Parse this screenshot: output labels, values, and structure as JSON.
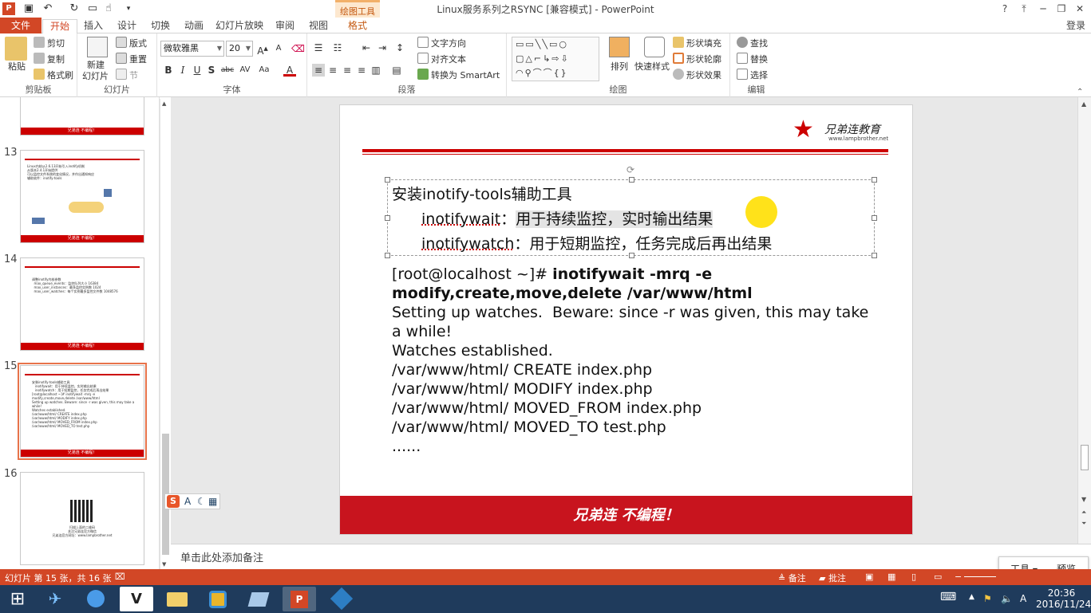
{
  "window": {
    "title": "Linux服务系列之RSYNC [兼容模式] - PowerPoint",
    "context_tab_group": "绘图工具",
    "help": "?",
    "minimize": "─",
    "restore": "❐",
    "close": "✕",
    "login": "登录"
  },
  "tabs": [
    "文件",
    "开始",
    "插入",
    "设计",
    "切换",
    "动画",
    "幻灯片放映",
    "审阅",
    "视图",
    "格式"
  ],
  "active_tab": "开始",
  "ribbon": {
    "clipboard": {
      "paste": "粘贴",
      "cut": "剪切",
      "copy": "复制",
      "format_painter": "格式刷",
      "label": "剪贴板"
    },
    "slides": {
      "new_slide": "新建",
      "new_slide2": "幻灯片",
      "layout": "版式",
      "reset": "重置",
      "section": "节",
      "label": "幻灯片"
    },
    "font": {
      "name": "微软雅黑",
      "size": "20",
      "bold": "B",
      "italic": "I",
      "underline": "U",
      "shadow": "S",
      "strike": "abc",
      "spacing": "AV",
      "case": "Aa",
      "color": "A",
      "label": "字体"
    },
    "paragraph": {
      "text_direction": "文字方向",
      "align_text": "对齐文本",
      "smartart": "转换为 SmartArt",
      "label": "段落"
    },
    "drawing": {
      "arrange": "排列",
      "quick_styles": "快速样式",
      "shape_fill": "形状填充",
      "shape_outline": "形状轮廓",
      "shape_effects": "形状效果",
      "label": "绘图"
    },
    "editing": {
      "find": "查找",
      "replace": "替换",
      "select": "选择",
      "label": "编辑"
    }
  },
  "thumbnails": [
    {
      "num": "13",
      "text": "Linux内核从2.6.13开始引入inotify机制\n从版本2.4.1开始提供\n可以监控文件系统的变化情况，并作出通知响应\n辅助软件：inotify-tools"
    },
    {
      "num": "14",
      "text": "调整inotify内核参数\n  max_queue_events：监控队列大小 16384\n  max_user_instances：最多监控实例数 1024\n  max_user_watches：每个实例最多监控文件数 1048576"
    },
    {
      "num": "15",
      "text": "安装inotify-tools辅助工具\n   inotifywait：用于持续监控，实时输出结果\n   inotifywatch：用于短期监控，任务完成后再出结果\n[root@localhost ~]# inotifywait -mrq -e\nmodify,create,move,delete /var/www/html\nSetting up watches. Beware: since -r was given, this may take a while!\nWatches established.\n/var/www/html/ CREATE index.php\n/var/www/html/ MODIFY index.php\n/var/www/html/ MOVED_FROM index.php\n/var/www/html/ MOVED_TO test.php"
    },
    {
      "num": "16",
      "text": "扫描上面的二维码\n关注兄弟连官方微信\n兄弟连官方网址：www.lampbrother.net"
    }
  ],
  "thumb_footer": "兄弟连 不编程！",
  "slide": {
    "logo_text": "兄弟连教育",
    "logo_url": "www.lampbrother.net",
    "heading": "安装inotify-tools辅助工具",
    "line1_term": "inotifywait",
    "line1_sep": "：",
    "line1_desc": "用于持续监控，实时输出结果",
    "line2_term": "inotifywatch",
    "line2_sep": "：",
    "line2_desc": "用于短期监控，任务完成后再出结果",
    "code_prompt": "[root@localhost ~]# ",
    "code_cmd1": "inotifywait -mrq -e",
    "code_cmd2": "modify,create,move,delete /var/www/html",
    "code_out": "Setting up watches.  Beware: since -r was given, this may take\na while!\nWatches established.\n/var/www/html/ CREATE index.php\n/var/www/html/ MODIFY index.php\n/var/www/html/ MOVED_FROM index.php\n/var/www/html/ MOVED_TO test.php\n......",
    "footer": "兄弟连 不编程！"
  },
  "notes_placeholder": "单击此处添加备注",
  "status": {
    "slide_info": "幻灯片 第 15 张，共 16 张",
    "notes": "备注",
    "comments": "批注"
  },
  "popup": {
    "tools": "工具",
    "preview": "预览"
  },
  "taskbar": {
    "time": "20:36",
    "date": "2016/11/24",
    "lang": "A"
  },
  "colors": {
    "accent": "#d24726",
    "slide_red": "#c8141e"
  }
}
